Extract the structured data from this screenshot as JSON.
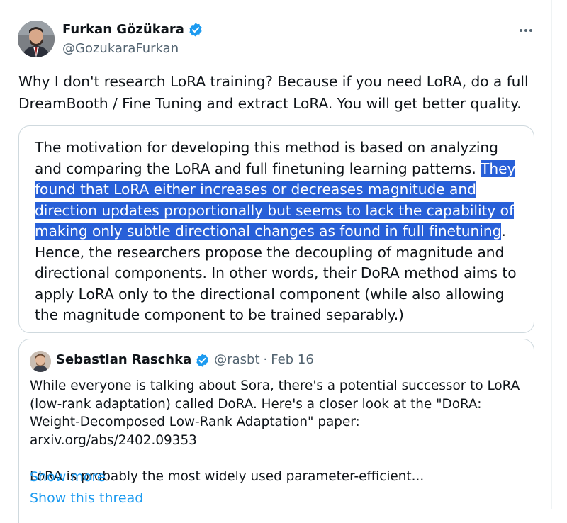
{
  "author": {
    "name": "Furkan Gözükara",
    "handle": "@GozukaraFurkan"
  },
  "tweet": {
    "text": "Why I don't research LoRA training? Because if you need LoRA, do a full DreamBooth / Fine Tuning and extract LoRA. You will get better quality."
  },
  "quote_image": {
    "text_before": "The motivation for developing this method is based on analyzing and comparing the LoRA and full finetuning learning patterns. ",
    "highlighted": "They found that LoRA either increases or decreases magnitude and direction updates proportionally but seems to lack the capability of making only subtle directional changes as found in full finetuning",
    "text_after": ". Hence, the researchers propose the decoupling of magnitude and directional components. In other words, their DoRA method aims to apply LoRA only to the directional component (while also allowing the magnitude component to be trained separably.)"
  },
  "quoted_tweet": {
    "name": "Sebastian Raschka",
    "handle": "@rasbt",
    "separator": "·",
    "date": "Feb 16",
    "text": "While everyone is talking about Sora, there's a potential successor to LoRA (low-rank adaptation) called DoRA. Here's a closer look at the \"DoRA: Weight-Decomposed Low-Rank Adaptation\" paper: arxiv.org/abs/2402.09353\n\nLoRA is probably the most widely used parameter-efficient...",
    "show_more": "Show more"
  },
  "show_thread": "Show this thread",
  "colors": {
    "verified": "#1d9bf0",
    "highlight": "#2860d8",
    "link": "#1d9bf0"
  }
}
